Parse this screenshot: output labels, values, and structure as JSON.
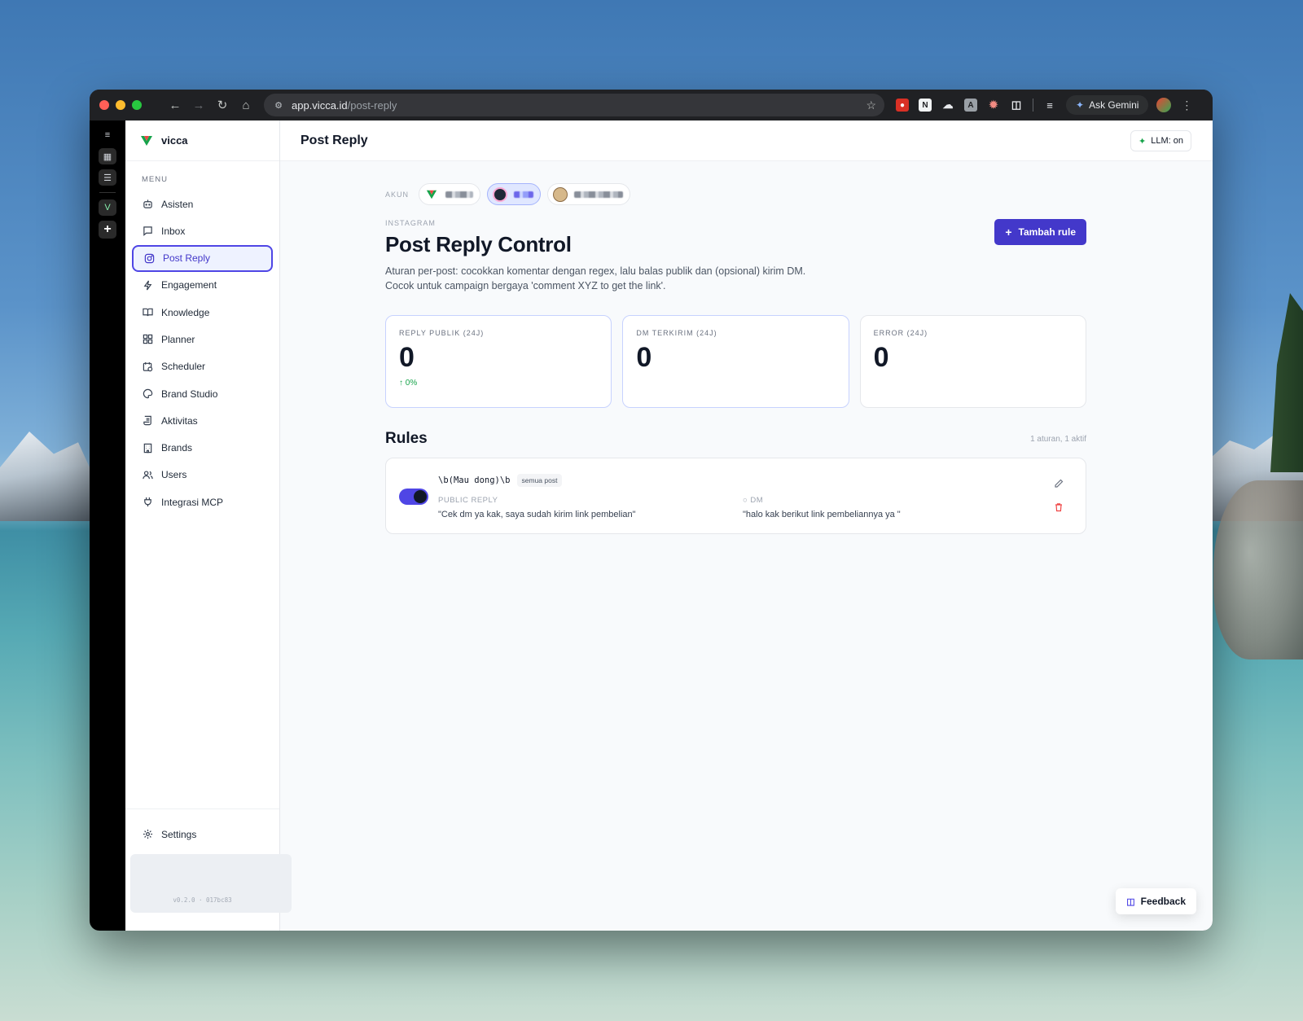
{
  "browser": {
    "url_host": "app.vicca.id",
    "url_path": "/post-reply",
    "ask_gemini": "Ask Gemini"
  },
  "sidebar": {
    "brand": "vicca",
    "menu_label": "MENU",
    "items": [
      {
        "label": "Asisten",
        "icon": "bot-icon"
      },
      {
        "label": "Inbox",
        "icon": "message-square-icon"
      },
      {
        "label": "Post Reply",
        "icon": "instagram-icon"
      },
      {
        "label": "Engagement",
        "icon": "zap-icon"
      },
      {
        "label": "Knowledge",
        "icon": "book-open-icon"
      },
      {
        "label": "Planner",
        "icon": "grid-icon"
      },
      {
        "label": "Scheduler",
        "icon": "calendar-clock-icon"
      },
      {
        "label": "Brand Studio",
        "icon": "palette-icon"
      },
      {
        "label": "Aktivitas",
        "icon": "scroll-icon"
      },
      {
        "label": "Brands",
        "icon": "building-icon"
      },
      {
        "label": "Users",
        "icon": "users-icon"
      },
      {
        "label": "Integrasi MCP",
        "icon": "plug-icon"
      }
    ],
    "active_index": 2,
    "settings_label": "Settings",
    "version": "v0.2.0 · 017bc83"
  },
  "topbar": {
    "title": "Post Reply",
    "llm_status": "LLM: on"
  },
  "accounts": {
    "label": "AKUN"
  },
  "header": {
    "eyebrow": "INSTAGRAM",
    "title": "Post Reply Control",
    "desc_line1": "Aturan per-post: cocokkan komentar dengan regex, lalu balas publik dan (opsional) kirim DM.",
    "desc_line2": "Cocok untuk campaign bergaya 'comment XYZ to get the link'.",
    "add_button": "Tambah rule"
  },
  "stats": [
    {
      "label": "REPLY PUBLIK (24J)",
      "value": "0",
      "delta": "0%"
    },
    {
      "label": "DM TERKIRIM (24J)",
      "value": "0"
    },
    {
      "label": "ERROR (24J)",
      "value": "0"
    }
  ],
  "rules": {
    "title": "Rules",
    "count": "1 aturan, 1 aktif",
    "items": [
      {
        "regex": "\\b(Mau dong)\\b",
        "scope": "semua post",
        "enabled": true,
        "public_reply_label": "PUBLIC REPLY",
        "public_reply": "\"Cek dm ya kak, saya sudah kirim link pembelian\"",
        "dm_label": "DM",
        "dm": "\"halo kak berikut link pembeliannya ya \""
      }
    ]
  },
  "feedback": "Feedback",
  "colors": {
    "accent": "#4338ca",
    "success": "#16a34a",
    "danger": "#ef4444"
  }
}
